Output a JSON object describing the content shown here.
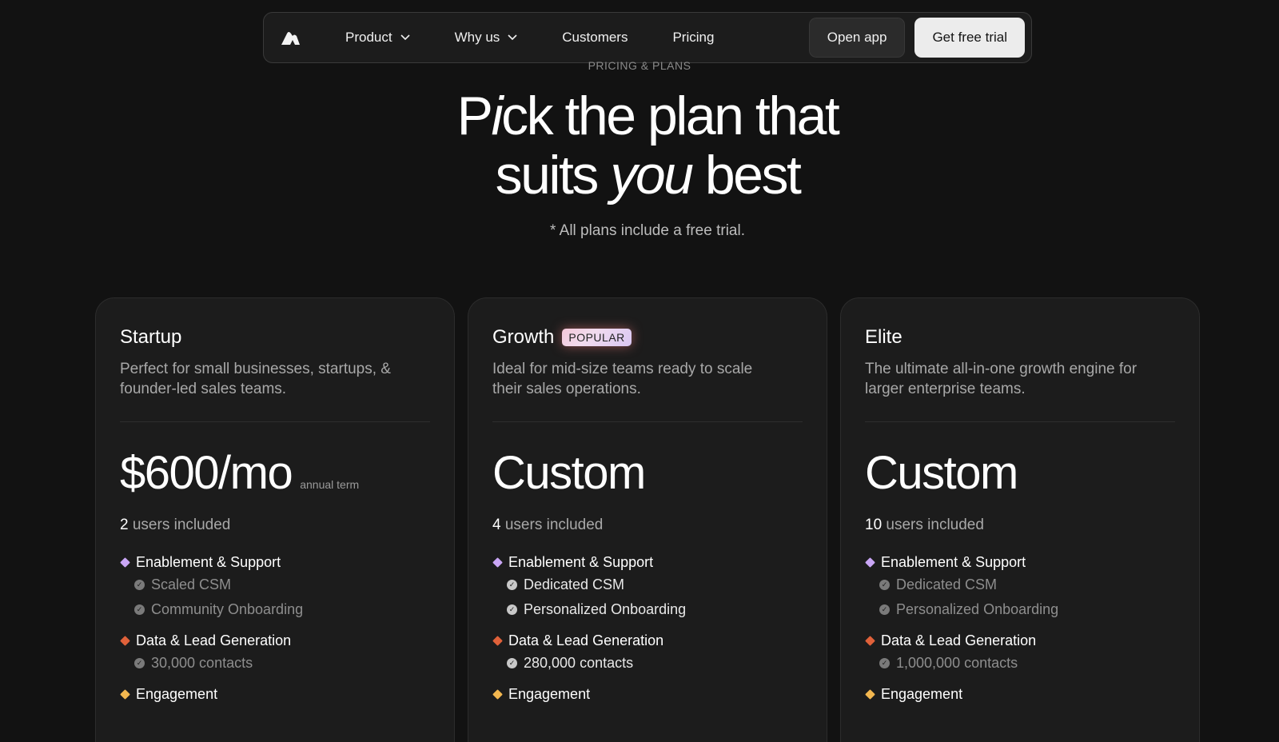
{
  "nav": {
    "logo": "brand-logo",
    "links": [
      {
        "label": "Product",
        "dropdown": true
      },
      {
        "label": "Why us",
        "dropdown": true
      },
      {
        "label": "Customers",
        "dropdown": false
      },
      {
        "label": "Pricing",
        "dropdown": false
      }
    ],
    "open_app": "Open app",
    "free_trial": "Get free trial"
  },
  "hero": {
    "eyebrow": "PRICING & PLANS",
    "headline_1a": "P",
    "headline_1b": "i",
    "headline_1c": "ck the plan that",
    "headline_2a": "suits ",
    "headline_2b": "you",
    "headline_2c": " best",
    "note": "* All plans include a free trial."
  },
  "colors": {
    "enablement": "#c9a6f5",
    "data": "#e0613a",
    "engagement": "#f3b74f"
  },
  "plans": [
    {
      "name": "Startup",
      "badge": "",
      "desc": "Perfect for small businesses, startups, & founder-led sales teams.",
      "price": "$600/mo",
      "price_note": "annual term",
      "users_num": "2",
      "users_text": " users included",
      "enablement": "Enablement & Support",
      "enablement_items": [
        "Scaled CSM",
        "Community Onboarding"
      ],
      "data_title": "Data & Lead Generation",
      "data_items": [
        "30,000 contacts"
      ],
      "engagement": "Engagement",
      "bright": false
    },
    {
      "name": "Growth",
      "badge": "POPULAR",
      "desc": "Ideal for mid-size teams ready to scale their sales operations.",
      "price": "Custom",
      "price_note": "",
      "users_num": "4",
      "users_text": " users included",
      "enablement": "Enablement & Support",
      "enablement_items": [
        "Dedicated CSM",
        "Personalized Onboarding"
      ],
      "data_title": "Data & Lead Generation",
      "data_items": [
        "280,000 contacts"
      ],
      "engagement": "Engagement",
      "bright": true
    },
    {
      "name": "Elite",
      "badge": "",
      "desc": "The ultimate all-in-one growth engine for larger enterprise teams.",
      "price": "Custom",
      "price_note": "",
      "users_num": "10",
      "users_text": " users included",
      "enablement": "Enablement & Support",
      "enablement_items": [
        "Dedicated CSM",
        "Personalized Onboarding"
      ],
      "data_title": "Data & Lead Generation",
      "data_items": [
        "1,000,000 contacts"
      ],
      "engagement": "Engagement",
      "bright": false
    }
  ]
}
